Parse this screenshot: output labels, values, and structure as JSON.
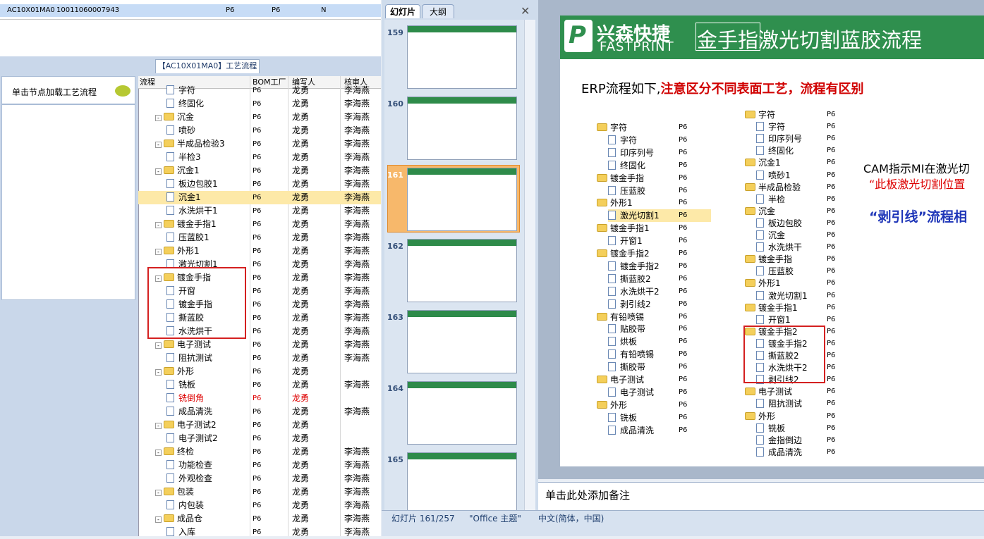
{
  "top_row": {
    "code": "AC10X01MA0",
    "no": "10011060007943",
    "f1": "P6",
    "f2": "P6",
    "f3": "N"
  },
  "left": {
    "tab_title": "【AC10X01MA0】工艺流程",
    "side_hint": "单击节点加载工艺流程",
    "headers": [
      "流程",
      "BOM工厂",
      "编写人",
      "核审人"
    ],
    "rows": [
      {
        "name": "字符",
        "lvl": 1,
        "f": "P6",
        "w": "龙勇",
        "r": "李海燕",
        "t": "doc"
      },
      {
        "name": "终固化",
        "lvl": 1,
        "f": "P6",
        "w": "龙勇",
        "r": "李海燕",
        "t": "doc"
      },
      {
        "name": "沉金",
        "lvl": 0,
        "f": "P6",
        "w": "龙勇",
        "r": "李海燕",
        "t": "folder"
      },
      {
        "name": "喷砂",
        "lvl": 1,
        "f": "P6",
        "w": "龙勇",
        "r": "李海燕",
        "t": "doc"
      },
      {
        "name": "半成品检验3",
        "lvl": 0,
        "f": "P6",
        "w": "龙勇",
        "r": "李海燕",
        "t": "folder"
      },
      {
        "name": "半检3",
        "lvl": 1,
        "f": "P6",
        "w": "龙勇",
        "r": "李海燕",
        "t": "doc"
      },
      {
        "name": "沉金1",
        "lvl": 0,
        "f": "P6",
        "w": "龙勇",
        "r": "李海燕",
        "t": "folder"
      },
      {
        "name": "板边包胶1",
        "lvl": 1,
        "f": "P6",
        "w": "龙勇",
        "r": "李海燕",
        "t": "doc"
      },
      {
        "name": "沉金1",
        "lvl": 1,
        "f": "P6",
        "w": "龙勇",
        "r": "李海燕",
        "t": "doc",
        "sel": true
      },
      {
        "name": "水洗烘干1",
        "lvl": 1,
        "f": "P6",
        "w": "龙勇",
        "r": "李海燕",
        "t": "doc"
      },
      {
        "name": "镀金手指1",
        "lvl": 0,
        "f": "P6",
        "w": "龙勇",
        "r": "李海燕",
        "t": "folder"
      },
      {
        "name": "压蓝胶1",
        "lvl": 1,
        "f": "P6",
        "w": "龙勇",
        "r": "李海燕",
        "t": "doc"
      },
      {
        "name": "外形1",
        "lvl": 0,
        "f": "P6",
        "w": "龙勇",
        "r": "李海燕",
        "t": "folder"
      },
      {
        "name": "激光切割1",
        "lvl": 1,
        "f": "P6",
        "w": "龙勇",
        "r": "李海燕",
        "t": "doc"
      },
      {
        "name": "镀金手指",
        "lvl": 0,
        "f": "P6",
        "w": "龙勇",
        "r": "李海燕",
        "t": "folder"
      },
      {
        "name": "开窗",
        "lvl": 1,
        "f": "P6",
        "w": "龙勇",
        "r": "李海燕",
        "t": "doc"
      },
      {
        "name": "镀金手指",
        "lvl": 1,
        "f": "P6",
        "w": "龙勇",
        "r": "李海燕",
        "t": "doc"
      },
      {
        "name": "撕蓝胶",
        "lvl": 1,
        "f": "P6",
        "w": "龙勇",
        "r": "李海燕",
        "t": "doc"
      },
      {
        "name": "水洗烘干",
        "lvl": 1,
        "f": "P6",
        "w": "龙勇",
        "r": "李海燕",
        "t": "doc"
      },
      {
        "name": "电子测试",
        "lvl": 0,
        "f": "P6",
        "w": "龙勇",
        "r": "李海燕",
        "t": "folder"
      },
      {
        "name": "阻抗测试",
        "lvl": 1,
        "f": "P6",
        "w": "龙勇",
        "r": "李海燕",
        "t": "doc"
      },
      {
        "name": "外形",
        "lvl": 0,
        "f": "P6",
        "w": "龙勇",
        "r": "",
        "t": "folder"
      },
      {
        "name": "铣板",
        "lvl": 1,
        "f": "P6",
        "w": "龙勇",
        "r": "李海燕",
        "t": "doc"
      },
      {
        "name": "铣倒角",
        "lvl": 1,
        "f": "P6",
        "w": "龙勇",
        "r": "",
        "t": "doc",
        "red": true
      },
      {
        "name": "成品清洗",
        "lvl": 1,
        "f": "P6",
        "w": "龙勇",
        "r": "李海燕",
        "t": "doc"
      },
      {
        "name": "电子测试2",
        "lvl": 0,
        "f": "P6",
        "w": "龙勇",
        "r": "",
        "t": "folder"
      },
      {
        "name": "电子测试2",
        "lvl": 1,
        "f": "P6",
        "w": "龙勇",
        "r": "",
        "t": "doc"
      },
      {
        "name": "终检",
        "lvl": 0,
        "f": "P6",
        "w": "龙勇",
        "r": "李海燕",
        "t": "folder"
      },
      {
        "name": "功能检查",
        "lvl": 1,
        "f": "P6",
        "w": "龙勇",
        "r": "李海燕",
        "t": "doc"
      },
      {
        "name": "外观检查",
        "lvl": 1,
        "f": "P6",
        "w": "龙勇",
        "r": "李海燕",
        "t": "doc"
      },
      {
        "name": "包装",
        "lvl": 0,
        "f": "P6",
        "w": "龙勇",
        "r": "李海燕",
        "t": "folder"
      },
      {
        "name": "内包装",
        "lvl": 1,
        "f": "P6",
        "w": "龙勇",
        "r": "李海燕",
        "t": "doc"
      },
      {
        "name": "成品仓",
        "lvl": 0,
        "f": "P6",
        "w": "龙勇",
        "r": "李海燕",
        "t": "folder"
      },
      {
        "name": "入库",
        "lvl": 1,
        "f": "P6",
        "w": "龙勇",
        "r": "李海燕",
        "t": "doc"
      }
    ]
  },
  "ppt": {
    "tab_slides": "幻灯片",
    "tab_outline": "大纲",
    "thumb_numbers": [
      "159",
      "160",
      "161",
      "162",
      "163",
      "164",
      "165"
    ],
    "current": "161",
    "status_slide": "幻灯片 161/257",
    "status_theme": "\"Office 主题\"",
    "status_lang": "中文(简体，中国)",
    "notes": "单击此处添加备注",
    "slide": {
      "logo_cn": "兴森快捷",
      "logo_en": "FASTPRINT",
      "logo_mark": "P",
      "title": "金手指激光切割蓝胶流程",
      "erp_prefix": "ERP流程如下,",
      "erp_red": "注意区分不同表面工艺，流程有区别",
      "cam": "CAM指示MI在激光切",
      "cam_quote": "“此板激光切割位置",
      "strip": "“剥引线”流程相",
      "tree_left": [
        {
          "n": "字符",
          "l": 0
        },
        {
          "n": "字符",
          "l": 1
        },
        {
          "n": "印序列号",
          "l": 1
        },
        {
          "n": "终固化",
          "l": 1
        },
        {
          "n": "镀金手指",
          "l": 0
        },
        {
          "n": "压蓝胶",
          "l": 1
        },
        {
          "n": "外形1",
          "l": 0
        },
        {
          "n": "激光切割1",
          "l": 1,
          "sel": true
        },
        {
          "n": "镀金手指1",
          "l": 0
        },
        {
          "n": "开窗1",
          "l": 1
        },
        {
          "n": "镀金手指2",
          "l": 0
        },
        {
          "n": "镀金手指2",
          "l": 1
        },
        {
          "n": "撕蓝胶2",
          "l": 1
        },
        {
          "n": "水洗烘干2",
          "l": 1
        },
        {
          "n": "剥引线2",
          "l": 1
        },
        {
          "n": "有铅喷锡",
          "l": 0
        },
        {
          "n": "贴胶带",
          "l": 1
        },
        {
          "n": "烘板",
          "l": 1
        },
        {
          "n": "有铅喷锡",
          "l": 1
        },
        {
          "n": "撕胶带",
          "l": 1
        },
        {
          "n": "电子测试",
          "l": 0
        },
        {
          "n": "电子测试",
          "l": 1
        },
        {
          "n": "外形",
          "l": 0
        },
        {
          "n": "铣板",
          "l": 1
        },
        {
          "n": "成品清洗",
          "l": 1
        }
      ],
      "tree_right": [
        {
          "n": "字符",
          "l": 0
        },
        {
          "n": "字符",
          "l": 1
        },
        {
          "n": "印序列号",
          "l": 1
        },
        {
          "n": "终固化",
          "l": 1
        },
        {
          "n": "沉金1",
          "l": 0
        },
        {
          "n": "喷砂1",
          "l": 1
        },
        {
          "n": "半成品检验",
          "l": 0
        },
        {
          "n": "半检",
          "l": 1
        },
        {
          "n": "沉金",
          "l": 0
        },
        {
          "n": "板边包胶",
          "l": 1
        },
        {
          "n": "沉金",
          "l": 1
        },
        {
          "n": "水洗烘干",
          "l": 1
        },
        {
          "n": "镀金手指",
          "l": 0
        },
        {
          "n": "压蓝胶",
          "l": 1
        },
        {
          "n": "外形1",
          "l": 0
        },
        {
          "n": "激光切割1",
          "l": 1
        },
        {
          "n": "镀金手指1",
          "l": 0
        },
        {
          "n": "开窗1",
          "l": 1
        },
        {
          "n": "镀金手指2",
          "l": 0
        },
        {
          "n": "镀金手指2",
          "l": 1
        },
        {
          "n": "撕蓝胶2",
          "l": 1
        },
        {
          "n": "水洗烘干2",
          "l": 1
        },
        {
          "n": "剥引线2",
          "l": 1
        },
        {
          "n": "电子测试",
          "l": 0
        },
        {
          "n": "阻抗测试",
          "l": 1
        },
        {
          "n": "外形",
          "l": 0
        },
        {
          "n": "铣板",
          "l": 1
        },
        {
          "n": "金指倒边",
          "l": 1
        },
        {
          "n": "成品清洗",
          "l": 1
        }
      ],
      "p6": "P6"
    }
  }
}
